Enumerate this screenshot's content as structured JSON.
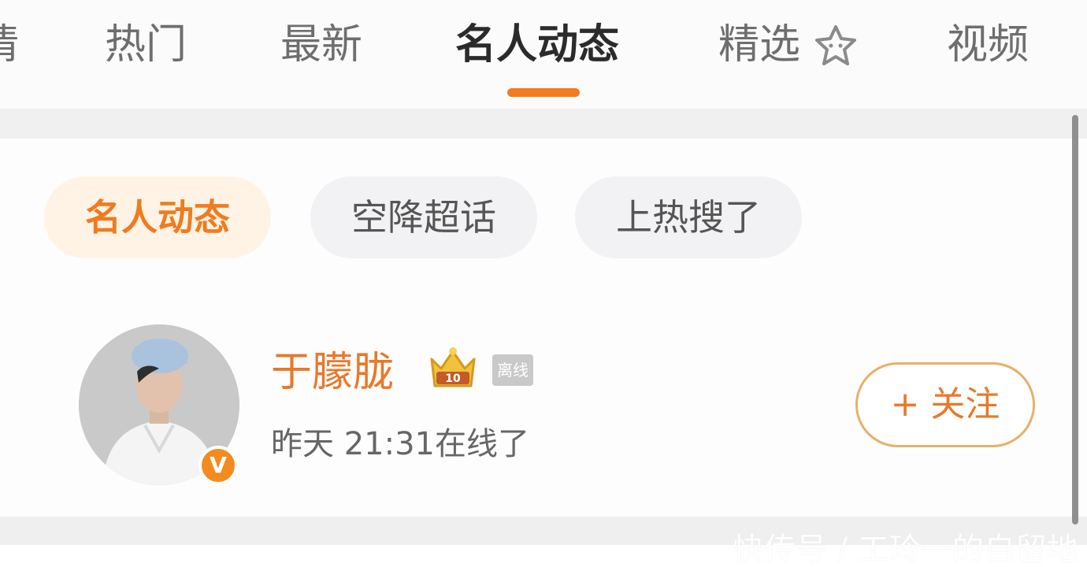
{
  "tabs": [
    {
      "label": "情"
    },
    {
      "label": "热门"
    },
    {
      "label": "最新"
    },
    {
      "label": "名人动态",
      "active": true
    },
    {
      "label": "精选"
    },
    {
      "label": "视频"
    }
  ],
  "colors": {
    "accent": "#f47b20",
    "chip_active_bg": "#fff3e6",
    "chip_bg": "#f2f2f4"
  },
  "icons": {
    "featured": "star-face-icon",
    "crown": "crown-level-10-icon",
    "verified": "verified-v-icon"
  },
  "chips": [
    {
      "label": "名人动态",
      "active": true
    },
    {
      "label": "空降超话"
    },
    {
      "label": "上热搜了"
    }
  ],
  "user": {
    "name": "于朦胧",
    "crown_level": "10",
    "offline_badge": "离线",
    "verified_mark": "V",
    "status": "昨天 21:31在线了",
    "follow_label": "+ 关注"
  },
  "watermark": "快传号 / 工玲一的自留地"
}
